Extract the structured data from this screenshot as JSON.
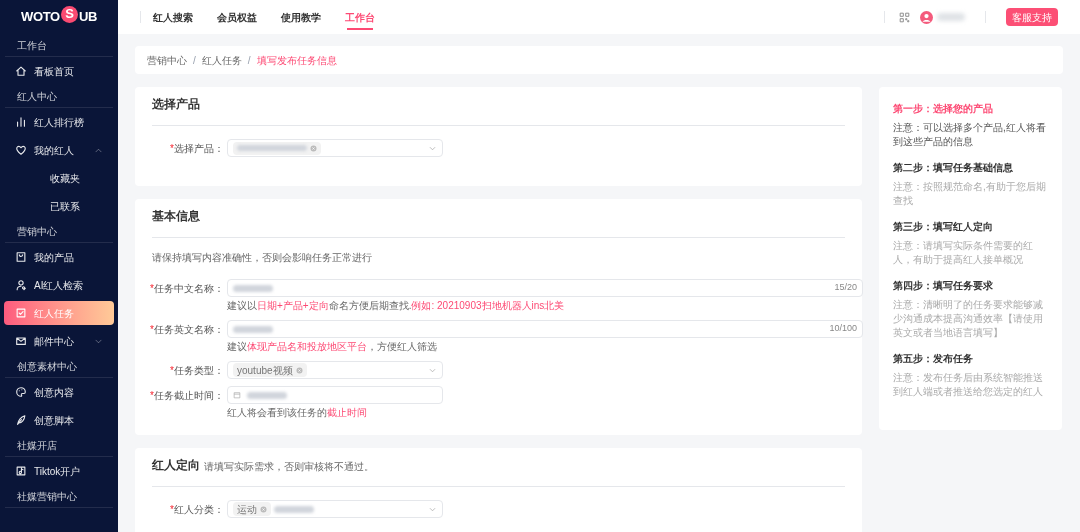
{
  "logo": {
    "left": "WOTO",
    "mark": "S",
    "right": "UB"
  },
  "sidebar": {
    "sections": [
      {
        "title": "工作台",
        "items": [
          {
            "label": "看板首页",
            "selected": false
          }
        ]
      },
      {
        "title": "红人中心",
        "items": [
          {
            "label": "红人排行榜",
            "selected": false
          },
          {
            "label": "我的红人",
            "selected": false,
            "expanded": true,
            "children": [
              {
                "label": "收藏夹",
                "selected": false
              },
              {
                "label": "已联系",
                "selected": false
              }
            ]
          }
        ]
      },
      {
        "title": "营销中心",
        "items": [
          {
            "label": "我的产品",
            "selected": false
          },
          {
            "label": "AI红人检索",
            "selected": false
          },
          {
            "label": "红人任务",
            "selected": true
          },
          {
            "label": "邮件中心",
            "selected": false,
            "expanded": false
          }
        ]
      },
      {
        "title": "创意素材中心",
        "items": [
          {
            "label": "创意内容",
            "selected": false
          },
          {
            "label": "创意脚本",
            "selected": false
          }
        ]
      },
      {
        "title": "社媒开店",
        "items": [
          {
            "label": "Tiktok开户",
            "selected": false
          }
        ]
      },
      {
        "title": "社媒营销中心"
      }
    ]
  },
  "top_nav": {
    "tabs": [
      {
        "label": "红人搜索",
        "selected": false
      },
      {
        "label": "会员权益",
        "selected": false
      },
      {
        "label": "使用教学",
        "selected": false
      },
      {
        "label": "工作台",
        "selected": true
      }
    ],
    "support_button": "客服支持"
  },
  "breadcrumb": [
    {
      "label": "营销中心",
      "separator_after": "/"
    },
    {
      "label": "红人任务",
      "separator_after": "/"
    },
    {
      "label": "填写发布任务信息"
    }
  ],
  "cards": [
    {
      "title": "选择产品",
      "fields": [
        {
          "kind": "select",
          "label": "选择产品：",
          "required_mark": "*",
          "value_hidden": true
        }
      ]
    },
    {
      "title": "基本信息",
      "note": "请保持填写内容准确性，否则会影响任务正常进行",
      "fields": [
        {
          "kind": "text",
          "label": "任务中文名称：",
          "required_mark": "*",
          "value_hidden": true,
          "counter": "15/20",
          "hint": [
            {
              "text": "建议以",
              "highlight": false
            },
            {
              "text": "日期+产品+定向",
              "highlight": true
            },
            {
              "text": "命名方便后期查找.",
              "highlight": false
            },
            {
              "text": "例如: 20210903扫地机器人ins北美",
              "highlight": true
            }
          ]
        },
        {
          "kind": "text",
          "label": "任务英文名称：",
          "required_mark": "*",
          "value_hidden": true,
          "counter": "10/100",
          "hint": [
            {
              "text": "建议",
              "highlight": false
            },
            {
              "text": "体现产品名和投放地区平台",
              "highlight": true
            },
            {
              "text": "，方便红人筛选",
              "highlight": false
            }
          ]
        },
        {
          "kind": "select",
          "label": "任务类型：",
          "required_mark": "*",
          "tags": [
            "youtube视频"
          ]
        },
        {
          "kind": "date",
          "label": "任务截止时间：",
          "required_mark": "*",
          "value_hidden": true,
          "hint": [
            {
              "text": "红人将会看到该任务的",
              "highlight": false
            },
            {
              "text": "截止时间",
              "highlight": true
            }
          ]
        }
      ]
    },
    {
      "title": "红人定向",
      "subtitle": "请填写实际需求，否则审核将不通过。",
      "fields": [
        {
          "kind": "select",
          "label": "红人分类：",
          "required_mark": "*",
          "tags": [
            "运动"
          ],
          "value_hidden": true
        }
      ]
    }
  ],
  "steps": [
    {
      "title": "第一步：选择您的产品",
      "note": "注意：可以选择多个产品,红人将看到这些产品的信息",
      "selected": true
    },
    {
      "title": "第二步：填写任务基础信息",
      "note": "注意：按照规范命名,有助于您后期查找",
      "selected": false
    },
    {
      "title": "第三步：填写红人定向",
      "note": "注意：请填写实际条件需要的红人，有助于提高红人接单概况",
      "selected": false
    },
    {
      "title": "第四步：填写任务要求",
      "note": "注意：清晰明了的任务要求能够减少沟通成本提高沟通效率【请使用英文或者当地语言填写】",
      "selected": false
    },
    {
      "title": "第五步：发布任务",
      "note": "注意：发布任务后由系统智能推送到红人端或者推送给您选定的红人",
      "selected": false
    }
  ]
}
